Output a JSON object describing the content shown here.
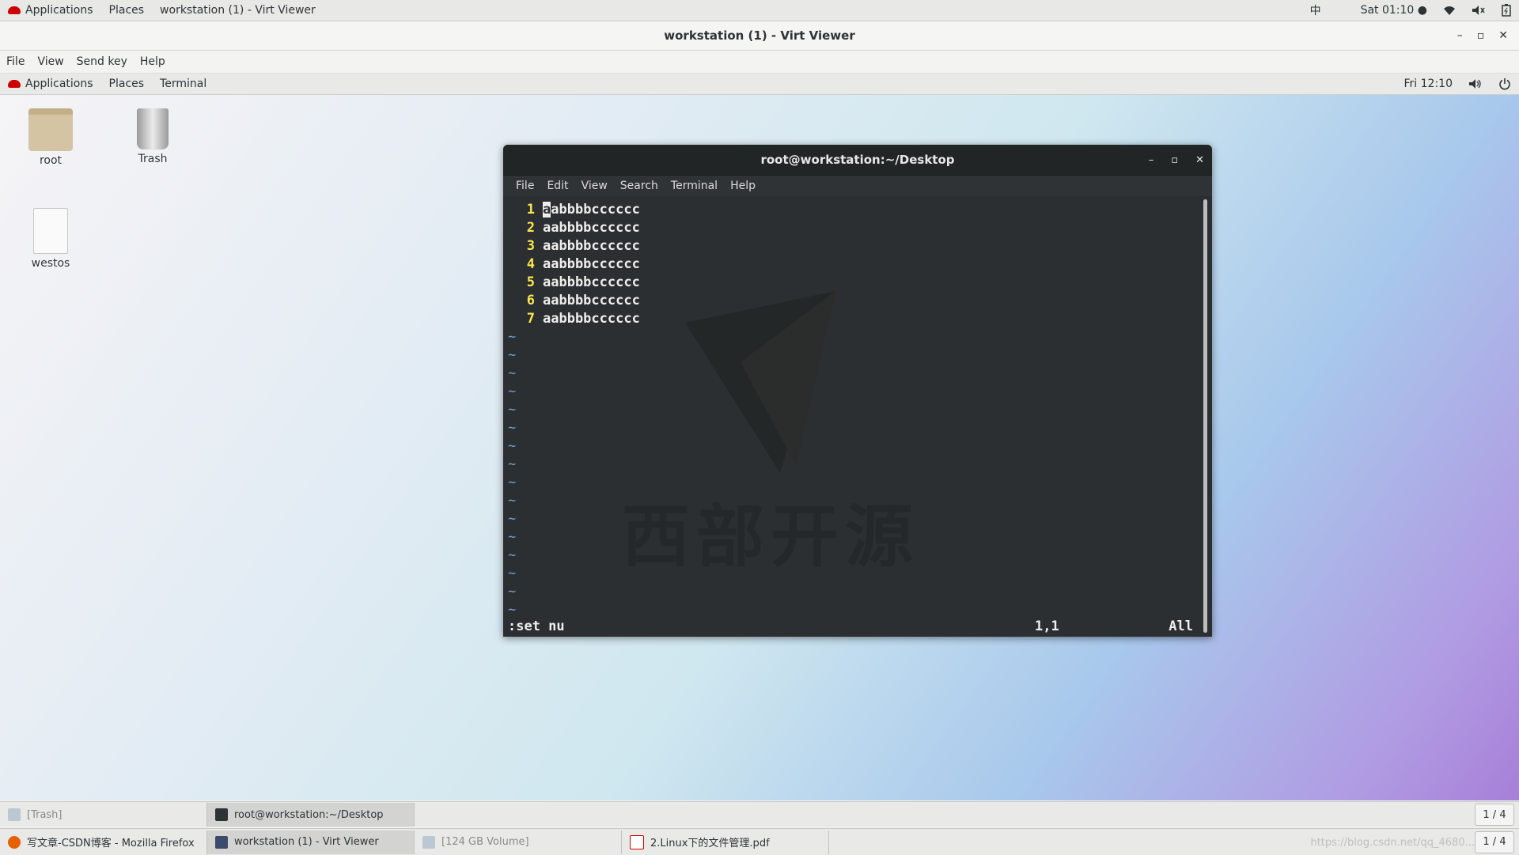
{
  "host_top": {
    "applications": "Applications",
    "places": "Places",
    "window_title": "workstation (1) - Virt Viewer",
    "input_method": "中",
    "clock": "Sat 01:10 ●"
  },
  "viewer": {
    "title": "workstation (1) - Virt Viewer",
    "menu": [
      "File",
      "View",
      "Send key",
      "Help"
    ]
  },
  "guest_top": {
    "applications": "Applications",
    "places": "Places",
    "terminal": "Terminal",
    "clock": "Fri 12:10"
  },
  "desktop_icons": [
    {
      "label": "root",
      "icon": "home-folder-icon"
    },
    {
      "label": "Trash",
      "icon": "trash-icon"
    },
    {
      "label": "westos",
      "icon": "text-file-icon"
    }
  ],
  "terminal": {
    "title": "root@workstation:~/Desktop",
    "menu": [
      "File",
      "Edit",
      "View",
      "Search",
      "Terminal",
      "Help"
    ],
    "lines": [
      {
        "num": "1",
        "text": "aabbbbcccccc"
      },
      {
        "num": "2",
        "text": "aabbbbcccccc"
      },
      {
        "num": "3",
        "text": "aabbbbcccccc"
      },
      {
        "num": "4",
        "text": "aabbbbcccccc"
      },
      {
        "num": "5",
        "text": "aabbbbcccccc"
      },
      {
        "num": "6",
        "text": "aabbbbcccccc"
      },
      {
        "num": "7",
        "text": "aabbbbcccccc"
      }
    ],
    "tilde": "~",
    "tilde_count": 16,
    "command": ":set nu",
    "position": "1,1",
    "scroll": "All",
    "watermark": "西部开源"
  },
  "guest_taskbar": {
    "tasks": [
      {
        "label": "[Trash]",
        "dim": true
      },
      {
        "label": "root@workstation:~/Desktop",
        "dim": false
      }
    ],
    "pager": "1 / 4"
  },
  "host_taskbar": {
    "tasks": [
      {
        "label": "写文章-CSDN博客 - Mozilla Firefox"
      },
      {
        "label": "workstation (1) - Virt Viewer"
      },
      {
        "label": "[124 GB Volume]"
      },
      {
        "label": "2.Linux下的文件管理.pdf"
      }
    ],
    "url": "https://blog.csdn.net/qq_4680...",
    "pager": "1 / 4"
  },
  "colors": {
    "line_number": "#fce94f",
    "tilde": "#729fcf",
    "brand_hat": "#cc0000"
  }
}
